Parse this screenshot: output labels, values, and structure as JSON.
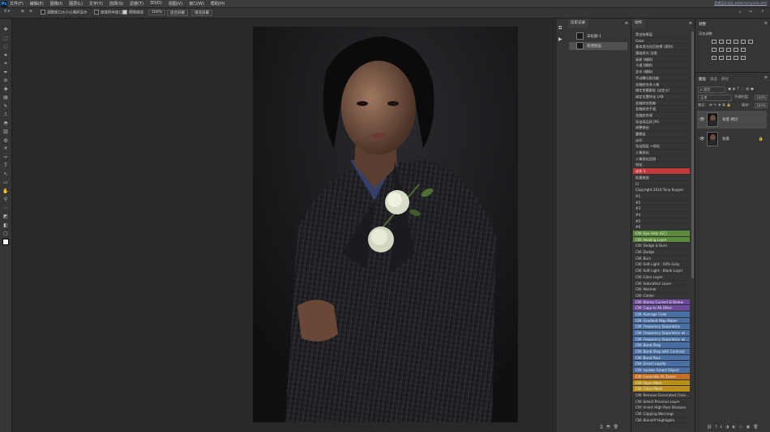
{
  "app": {
    "logo": "Ps",
    "watermark": "思缘设计论坛 www.missyuan.com"
  },
  "menu": [
    "文件(F)",
    "编辑(E)",
    "图像(I)",
    "图层(L)",
    "文字(Y)",
    "选择(S)",
    "滤镜(T)",
    "3D(D)",
    "视图(V)",
    "窗口(W)",
    "帮助(H)"
  ],
  "options": {
    "resize_windows": "调整窗口大小以满屏显示",
    "zoom_all": "缩放所有窗口",
    "scrubby_zoom": "细微缩放",
    "zoom_percent": "100%",
    "fit_screen": "适合屏幕",
    "fill_screen": "填充屏幕"
  },
  "history": {
    "tab": "历史记录",
    "items": [
      {
        "label": "未标题-1",
        "selected": false
      },
      {
        "label": "新建图层",
        "selected": true
      }
    ]
  },
  "actions": {
    "tab": "动作",
    "items": [
      {
        "label": "黑白效果层",
        "color": ""
      },
      {
        "label": "Gaze",
        "color": ""
      },
      {
        "label": "基本用光化后效果 (柔和)",
        "color": ""
      },
      {
        "label": "基础用光 治理",
        "color": ""
      },
      {
        "label": "画册 (辅助)",
        "color": ""
      },
      {
        "label": "卡通 (辅助)",
        "color": ""
      },
      {
        "label": "金辛 (辅助)",
        "color": ""
      },
      {
        "label": "手动曝光助功能",
        "color": ""
      },
      {
        "label": "金融综合多人像",
        "color": ""
      },
      {
        "label": "绑定常量都处 (自定义)",
        "color": ""
      },
      {
        "label": "绑定位置转化 LAB",
        "color": ""
      },
      {
        "label": "金融综合图像",
        "color": ""
      },
      {
        "label": "金融综合手画",
        "color": ""
      },
      {
        "label": "金融综合调",
        "color": ""
      },
      {
        "label": "导出高品质 JPG",
        "color": ""
      },
      {
        "label": "调整输出",
        "color": ""
      },
      {
        "label": "震撼出",
        "color": ""
      },
      {
        "label": "去印",
        "color": ""
      },
      {
        "label": "导出图层 +锐化",
        "color": ""
      },
      {
        "label": "人像锐化",
        "color": ""
      },
      {
        "label": "人像锐化回测",
        "color": ""
      },
      {
        "label": "锐化",
        "color": ""
      },
      {
        "label": "动作 1",
        "color": "#c0393b"
      },
      {
        "label": "批量缩放",
        "color": ""
      },
      {
        "label": "CI",
        "color": ""
      },
      {
        "label": "Copyright 2014 Tony Kuyper",
        "color": ""
      },
      {
        "label": "#1",
        "color": ""
      },
      {
        "label": "#2",
        "color": ""
      },
      {
        "label": "#3",
        "color": ""
      },
      {
        "label": "#4",
        "color": ""
      },
      {
        "label": "#5",
        "color": ""
      },
      {
        "label": "#6",
        "color": ""
      },
      {
        "label": "CW: Eye Help (GC)",
        "color": "#5a8a3a"
      },
      {
        "label": "CW: Healing Layer",
        "color": "#5a8a3a"
      },
      {
        "label": "CW: Dodge & Burn",
        "color": ""
      },
      {
        "label": "CW: Dodge",
        "color": ""
      },
      {
        "label": "CW: Burn",
        "color": ""
      },
      {
        "label": "CW: Soft Light - 50% Gray",
        "color": ""
      },
      {
        "label": "CW: Soft Light - Blank Layer",
        "color": ""
      },
      {
        "label": "CW: Color Layer",
        "color": ""
      },
      {
        "label": "CW: Saturation Layer",
        "color": ""
      },
      {
        "label": "CW: Warmer",
        "color": ""
      },
      {
        "label": "CW: Colder",
        "color": ""
      },
      {
        "label": "CW: Stamp Current & Below",
        "color": "#6b4a9a"
      },
      {
        "label": "CW: Copy to All Other",
        "color": "#6b4a9a"
      },
      {
        "label": "CW: Average Color",
        "color": "#4a6fa5"
      },
      {
        "label": "CW: Gradient Map Maker",
        "color": "#4a6fa5"
      },
      {
        "label": "CW: Frequency Separation",
        "color": "#4a6fa5"
      },
      {
        "label": "CW: Frequency Separation wi...",
        "color": "#4a6fa5"
      },
      {
        "label": "CW: Frequency Separation wi...",
        "color": "#4a6fa5"
      },
      {
        "label": "CW: Band Stop",
        "color": "#4a6fa5"
      },
      {
        "label": "CW: Band Stop with Contrast",
        "color": "#4a6fa5"
      },
      {
        "label": "CW: Band Pass",
        "color": "#4a6fa5"
      },
      {
        "label": "CW: Smart Liquify",
        "color": "#4a6fa5"
      },
      {
        "label": "CW: Update Smart Object",
        "color": "#4a6fa5"
      },
      {
        "label": "CW: Generate All Zones",
        "color": "#c07020"
      },
      {
        "label": "CW: Open Mask",
        "color": "#b8901a"
      },
      {
        "label": "CW: Close Mask",
        "color": "#b8901a"
      },
      {
        "label": "CW: Remove Generated Chan...",
        "color": ""
      },
      {
        "label": "CW: Select Previous Layer",
        "color": ""
      },
      {
        "label": "CW: Invert High Pass Sharpen",
        "color": ""
      },
      {
        "label": "CW: Clipping Warnings",
        "color": ""
      },
      {
        "label": "CW: Blend-If Highlights",
        "color": ""
      }
    ]
  },
  "adjustments": {
    "tab": "调整",
    "add_label": "添加调整"
  },
  "layers": {
    "tabs": [
      "图层",
      "通道",
      "路径"
    ],
    "filter_kind": "ρ 类型",
    "blend_mode": "正常",
    "opacity_label": "不透明度:",
    "opacity_value": "100%",
    "lock_label": "锁定:",
    "fill_label": "填充:",
    "fill_value": "100%",
    "items": [
      {
        "name": "背景 拷贝",
        "selected": true
      },
      {
        "name": "背景",
        "selected": false
      }
    ]
  }
}
